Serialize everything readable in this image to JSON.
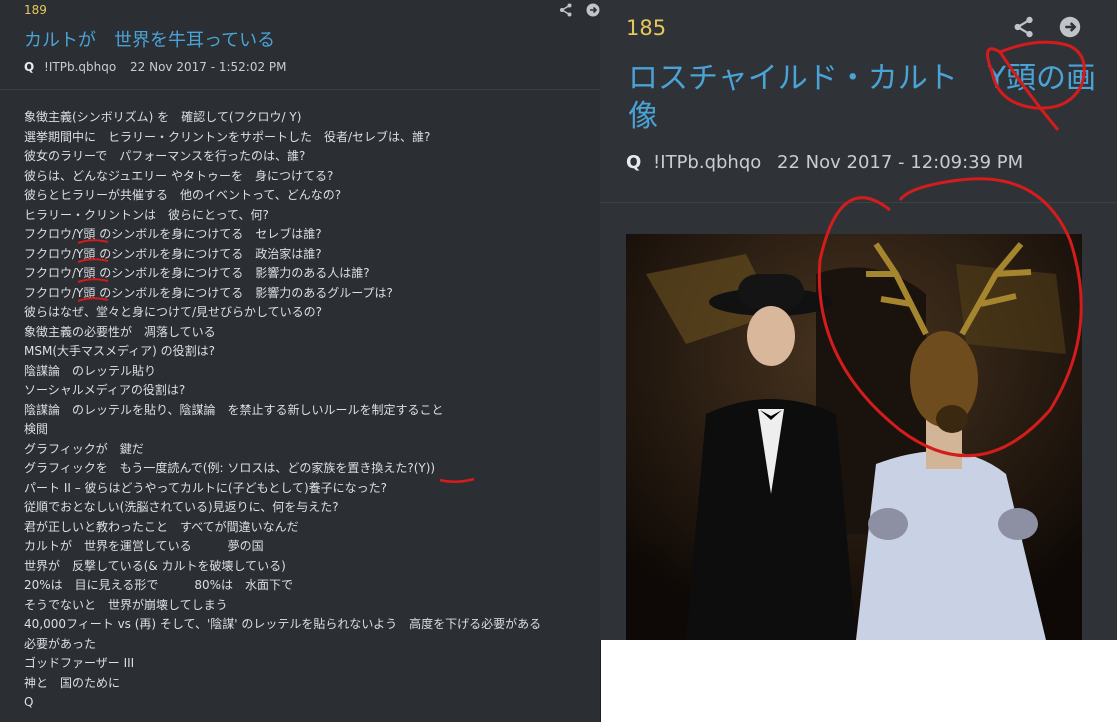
{
  "left_post": {
    "number": "189",
    "title": "カルトが　世界を牛耳っている",
    "author": "Q",
    "tripcode": "!ITPb.qbhqo",
    "timestamp": "22 Nov 2017 - 1:52:02 PM",
    "lines": [
      "象徴主義(シンボリズム) を　確認して(フクロウ/ Y)",
      "選挙期間中に　ヒラリー・クリントンをサポートした　役者/セレブは、誰?",
      "彼女のラリーで　パフォーマンスを行ったのは、誰?",
      "彼らは、どんなジュエリー やタトゥーを　身につけてる?",
      "彼らとヒラリーが共催する　他のイベントって、どんなの?",
      "ヒラリー・クリントンは　彼らにとって、何?",
      "フクロウ/Y頭 のシンボルを身につけてる　セレブは誰?",
      "フクロウ/Y頭 のシンボルを身につけてる　政治家は誰?",
      "フクロウ/Y頭 のシンボルを身につけてる　影響力のある人は誰?",
      "フクロウ/Y頭 のシンボルを身につけてる　影響力のあるグループは?",
      "彼らはなぜ、堂々と身につけて/見せびらかしているの?",
      "象徴主義の必要性が　凋落している",
      "MSM(大手マスメディア) の役割は?",
      "陰謀論　のレッテル貼り",
      "ソーシャルメディアの役割は?",
      "陰謀論　のレッテルを貼り、陰謀論　を禁止する新しいルールを制定すること",
      "検閲",
      "グラフィックが　鍵だ",
      "グラフィックを　もう一度読んで(例: ソロスは、どの家族を置き換えた?(Y))",
      "パート II – 彼らはどうやってカルトに(子どもとして)養子になった?",
      "従順でおとなしい(洗脳されている)見返りに、何を与えた?",
      "君が正しいと教わったこと　すべてが間違いなんだ",
      "カルトが　世界を運営している　　　夢の国",
      "世界が　反撃している(& カルトを破壊している)",
      "20%は　目に見える形で　　　80%は　水面下で",
      "そうでないと　世界が崩壊してしまう",
      "40,000フィート vs (再) そして、'陰謀' のレッテルを貼られないよう　高度を下げる必要がある",
      "必要があった",
      "ゴッドファーザー III",
      "神と　国のために",
      "Q"
    ]
  },
  "right_post": {
    "number": "185",
    "title": "ロスチャイルド・カルト　Y頭の画像",
    "author": "Q",
    "tripcode": "!ITPb.qbhqo",
    "timestamp": "22 Nov 2017 - 12:09:39 PM"
  },
  "icons": [
    "share-icon",
    "arrow-circle-icon"
  ],
  "colors": {
    "panel_bg": "#2b2e33",
    "title": "#4aa3d6",
    "post_number": "#e6c85a",
    "annotation": "#d41c1c"
  }
}
